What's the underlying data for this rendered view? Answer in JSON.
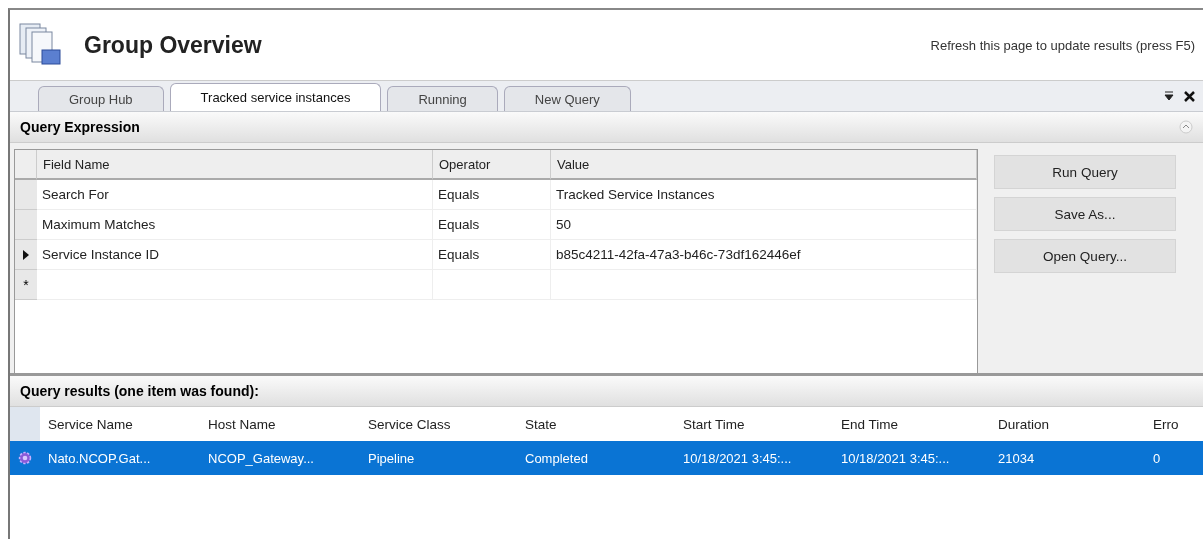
{
  "header": {
    "title": "Group Overview",
    "hint": "Refresh this page to update results (press F5)"
  },
  "tabs": [
    {
      "label": "Group Hub",
      "selected": false
    },
    {
      "label": "Tracked service instances",
      "selected": true
    },
    {
      "label": "Running",
      "selected": false
    },
    {
      "label": "New Query",
      "selected": false
    }
  ],
  "query_expression": {
    "title": "Query Expression",
    "columns": [
      "Field Name",
      "Operator",
      "Value"
    ],
    "rows": [
      {
        "field": "Search For",
        "operator": "Equals",
        "value": "Tracked Service Instances",
        "selected": false
      },
      {
        "field": "Maximum Matches",
        "operator": "Equals",
        "value": "50",
        "selected": false
      },
      {
        "field": "Service Instance ID",
        "operator": "Equals",
        "value": "b85c4211-42fa-47a3-b46c-73df162446ef",
        "selected": true
      }
    ],
    "new_row_marker": "*",
    "buttons": [
      "Run Query",
      "Save As...",
      "Open Query..."
    ]
  },
  "results": {
    "title": "Query results (one item was found):",
    "columns": [
      "Service Name",
      "Host Name",
      "Service Class",
      "State",
      "Start Time",
      "End Time",
      "Duration",
      "Erro"
    ],
    "rows": [
      {
        "cells": [
          "Nato.NCOP.Gat...",
          "NCOP_Gateway...",
          "Pipeline",
          "Completed",
          "10/18/2021 3:45:...",
          "10/18/2021 3:45:...",
          "21034",
          "0"
        ],
        "selected": true
      }
    ]
  }
}
